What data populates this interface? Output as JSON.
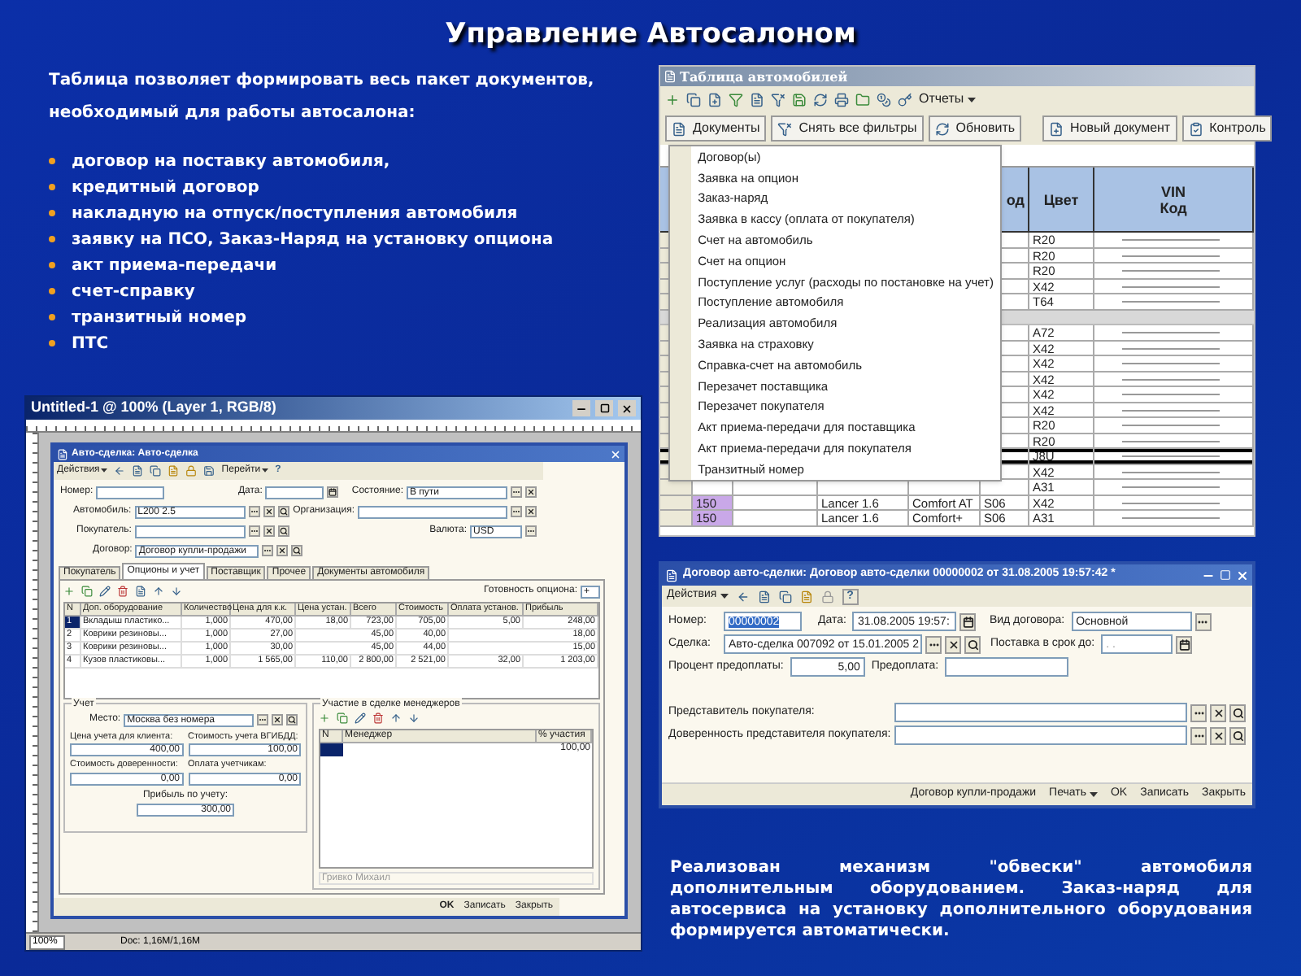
{
  "title": "Управление Автосалоном",
  "intro": "Таблица позволяет формировать весь пакет документов, необходимый для работы автосалона:",
  "bullets": [
    "договор на поставку автомобиля,",
    "кредитный договор",
    "накладную на отпуск/поступления автомобиля",
    "заявку на ПСО, Заказ-Наряд на установку опциона",
    "акт приема-передачи",
    "счет-справку",
    "транзитный номер",
    "ПТС"
  ],
  "left_window": {
    "title": "Untitled-1 @ 100% (Layer 1, RGB/8)",
    "form": {
      "title": "Авто-сделка: Авто-сделка",
      "menus": [
        "Действия",
        "Перейти"
      ],
      "help": "?",
      "number": {
        "label": "Номер:"
      },
      "date": {
        "label": "Дата:"
      },
      "state": {
        "label": "Состояние:",
        "value": "В пути"
      },
      "car": {
        "label": "Автомобиль:",
        "value": "L200 2.5"
      },
      "org": {
        "label": "Организация:"
      },
      "buyer": {
        "label": "Покупатель:"
      },
      "currency": {
        "label": "Валюта:",
        "value": "USD"
      },
      "contract": {
        "label": "Договор:",
        "value": "Договор купли-продажи"
      },
      "tabs": [
        {
          "label": "Покупатель",
          "selected": false
        },
        {
          "label": "Опционы и учет",
          "selected": true
        },
        {
          "label": "Поставщик",
          "selected": false
        },
        {
          "label": "Прочее",
          "selected": false
        },
        {
          "label": "Документы автомобиля",
          "selected": false
        }
      ],
      "readiness": {
        "label": "Готовность опциона:",
        "value": "+"
      },
      "options_table": {
        "columns": [
          "N",
          "Доп. оборудование",
          "Количество",
          "Цена для к.к.",
          "Цена устан.",
          "Всего",
          "Стоимость",
          "Оплата установ.",
          "Прибыль"
        ],
        "rows": [
          {
            "selected": true,
            "cells": [
              "1",
              "Вкладыш пластико...",
              "1,000",
              "470,00",
              "18,00",
              "723,00",
              "705,00",
              "5,00",
              "248,00"
            ]
          },
          {
            "selected": false,
            "cells": [
              "2",
              "Коврики резиновы...",
              "1,000",
              "27,00",
              null,
              "45,00",
              "40,00",
              null,
              "18,00"
            ]
          },
          {
            "selected": false,
            "cells": [
              "3",
              "Коврики резиновы...",
              "1,000",
              "30,00",
              null,
              "45,00",
              "44,00",
              null,
              "15,00"
            ]
          },
          {
            "selected": false,
            "cells": [
              "4",
              "Кузов пластиковы...",
              "1,000",
              "1 565,00",
              "110,00",
              "2 800,00",
              "2 521,00",
              "32,00",
              "1 203,00"
            ]
          }
        ]
      },
      "accounting": {
        "title": "Учет",
        "place": {
          "label": "Место:",
          "value": "Москва без номера"
        },
        "amounts": [
          {
            "label": "Цена учета для клиента:",
            "value": "400,00"
          },
          {
            "label": "Стоимость учета ВГИБДД:",
            "value": "100,00"
          },
          {
            "label": "Стоимость доверенности:",
            "value": "0,00"
          },
          {
            "label": "Оплата учетчикам:",
            "value": "0,00"
          },
          {
            "label": "Прибыль по учету:",
            "value": "300,00"
          }
        ]
      },
      "managers": {
        "title": "Участие в сделке менеджеров",
        "columns": [
          "N",
          "Менеджер",
          "% участия"
        ],
        "rows": [
          {
            "selected": true,
            "share": "100,00"
          }
        ],
        "footer": "Гривко Михаил"
      },
      "buttons": [
        "OK",
        "Записать",
        "Закрыть"
      ]
    },
    "status": {
      "zoom": "100%",
      "doc": "Doc: 1,16M/1,16M"
    }
  },
  "cars_window": {
    "title": "Таблица автомобилей",
    "reports": "Отчеты",
    "buttons": [
      "Документы",
      "Снять все фильтры",
      "Обновить",
      "Новый документ",
      "Контроль"
    ],
    "menu": [
      "Договор(ы)",
      "Заявка на опцион",
      "Заказ-наряд",
      "Заявка в кассу (оплата от покупателя)",
      "Счет на автомобиль",
      "Счет на опцион",
      "Поступление услуг (расходы по постановке на учет)",
      "Поступление автомобиля",
      "Реализация автомобиля",
      "Заявка на страховку",
      "Справка-счет на автомобиль",
      "Перезачет поставщика",
      "Перезачет покупателя",
      "Акт приема-передачи для поставщика",
      "Акт приема-передачи для покупателя",
      "Транзитный номер"
    ],
    "header": {
      "code": "од",
      "paint": "Цвет",
      "vin": "VIN\nКод"
    },
    "rows": [
      {
        "kind": "car",
        "selected": false,
        "paint": "R20"
      },
      {
        "kind": "car",
        "selected": false,
        "paint": "R20"
      },
      {
        "kind": "car",
        "selected": false,
        "paint": "R20"
      },
      {
        "kind": "car",
        "selected": false,
        "paint": "X42"
      },
      {
        "kind": "car",
        "selected": false,
        "paint": "T64"
      },
      {
        "kind": "group"
      },
      {
        "kind": "car",
        "selected": false,
        "paint": "A72"
      },
      {
        "kind": "car",
        "selected": false,
        "paint": "X42"
      },
      {
        "kind": "car",
        "selected": false,
        "paint": "X42"
      },
      {
        "kind": "car",
        "selected": false,
        "paint": "X42"
      },
      {
        "kind": "car",
        "selected": false,
        "paint": "X42"
      },
      {
        "kind": "car",
        "selected": false,
        "paint": "X42"
      },
      {
        "kind": "car",
        "selected": false,
        "paint": "R20"
      },
      {
        "kind": "car",
        "selected": false,
        "paint": "R20"
      },
      {
        "kind": "car",
        "selected": true,
        "paint": "J8U"
      },
      {
        "kind": "car",
        "selected": false,
        "paint": "X42"
      },
      {
        "kind": "car",
        "selected": false,
        "paint": "A31"
      },
      {
        "kind": "car",
        "selected": false,
        "number": "150",
        "model": "Lancer 1.6",
        "trim": "Comfort AT",
        "code": "S06",
        "paint": "X42"
      },
      {
        "kind": "car",
        "selected": false,
        "number": "150",
        "model": "Lancer 1.6",
        "trim": "Comfort+",
        "code": "S06",
        "paint": "A31"
      }
    ]
  },
  "contract_window": {
    "title": "Договор авто-сделки: Договор авто-сделки 00000002 от 31.08.2005 19:57:42 *",
    "menu": "Действия",
    "help": "?",
    "number": {
      "label": "Номер:",
      "value": "00000002",
      "selected": true
    },
    "date": {
      "label": "Дата:",
      "value": "31.08.2005 19:57:"
    },
    "kind": {
      "label": "Вид договора:",
      "value": "Основной"
    },
    "deal": {
      "label": "Сделка:",
      "value": "Авто-сделка 007092 от 15.01.2005 2"
    },
    "delivery": {
      "label": "Поставка в срок до:",
      "placeholder": ". ."
    },
    "prepay_percent": {
      "label": "Процент предоплаты:",
      "value": "5,00"
    },
    "prepay": {
      "label": "Предоплата:"
    },
    "representative": {
      "label": "Представитель покупателя:"
    },
    "power": {
      "label": "Доверенность представителя покупателя:"
    },
    "buttons": [
      {
        "label": "Договор купли-продажи",
        "dropdown": false
      },
      {
        "label": "Печать",
        "dropdown": true
      },
      {
        "label": "OK",
        "dropdown": false
      },
      {
        "label": "Записать",
        "dropdown": false
      },
      {
        "label": "Закрыть",
        "dropdown": false
      }
    ]
  },
  "note": "Реализован механизм \"обвески\" автомобиля дополнительным оборудованием. Заказ-наряд для автосервиса на установку дополнительного оборудования формируется автоматически."
}
